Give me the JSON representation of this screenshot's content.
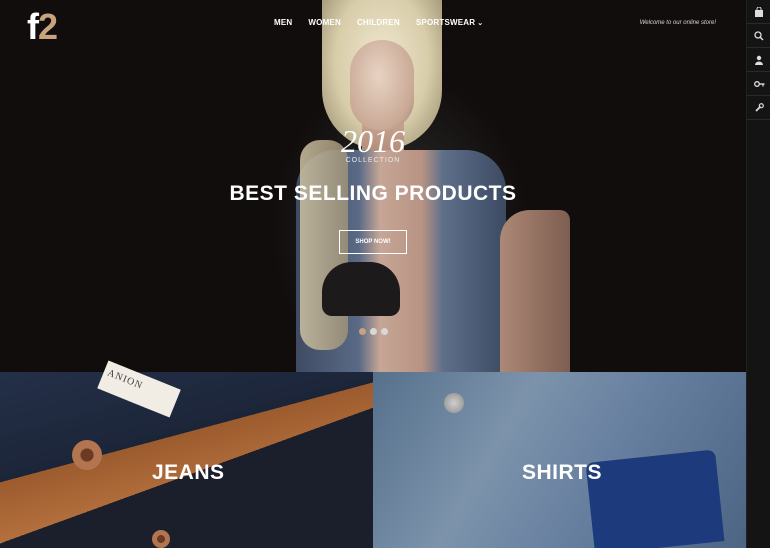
{
  "brand": {
    "logo_f": "f",
    "logo_2": "2"
  },
  "nav": {
    "items": [
      {
        "label": "MEN"
      },
      {
        "label": "WOMEN"
      },
      {
        "label": "CHILDREN"
      },
      {
        "label": "SPORTSWEAR",
        "has_dropdown": true
      }
    ]
  },
  "header": {
    "welcome": "Welcome to our online store!"
  },
  "hero": {
    "year": "2016",
    "collection": "COLLECTION",
    "headline": "BEST SELLING PRODUCTS",
    "button_label": "SHOP NOW!",
    "slides_count": 3,
    "active_slide": 1
  },
  "sidebar": {
    "icons": [
      "bag-icon",
      "search-icon",
      "user-icon",
      "key-icon",
      "wrench-icon"
    ]
  },
  "categories": [
    {
      "title": "JEANS"
    },
    {
      "title": "SHIRTS"
    }
  ],
  "colors": {
    "accent": "#c9a27e",
    "dark": "#0c0909",
    "sidebar": "#141414"
  }
}
